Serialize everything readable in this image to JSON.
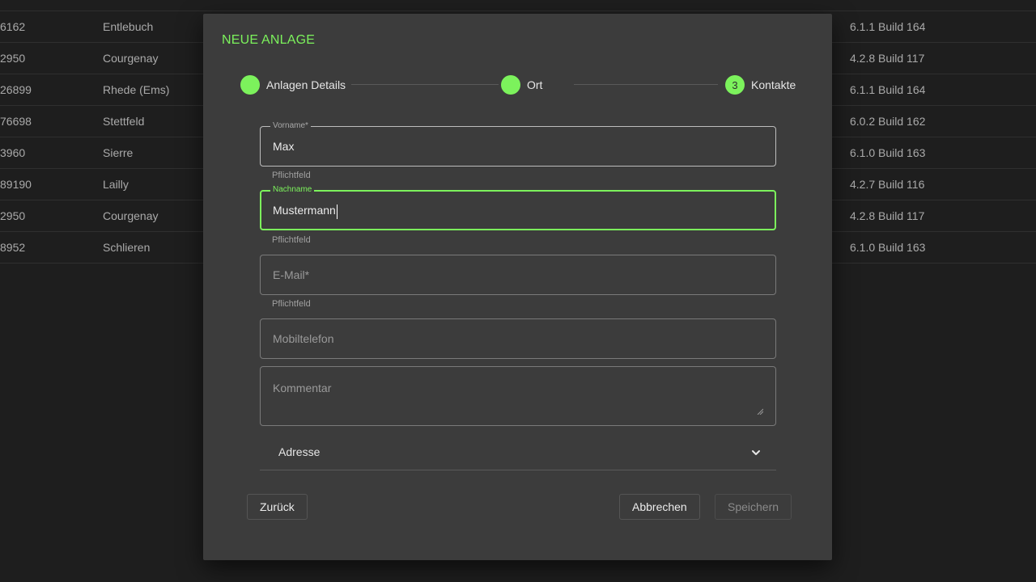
{
  "background_table": {
    "rows": [
      {
        "id": "6162",
        "city": "Entlebuch",
        "version": "6.1.1 Build 164"
      },
      {
        "id": "2950",
        "city": "Courgenay",
        "version": "4.2.8 Build 117"
      },
      {
        "id": "26899",
        "city": "Rhede (Ems)",
        "version": "6.1.1 Build 164"
      },
      {
        "id": "76698",
        "city": "Stettfeld",
        "version": "6.0.2 Build 162"
      },
      {
        "id": "3960",
        "city": "Sierre",
        "version": "6.1.0 Build 163"
      },
      {
        "id": "89190",
        "city": "Lailly",
        "version": "4.2.7 Build 116"
      },
      {
        "id": "2950",
        "city": "Courgenay",
        "version": "4.2.8 Build 117"
      },
      {
        "id": "8952",
        "city": "Schlieren",
        "version": "6.1.0 Build 163"
      }
    ]
  },
  "dialog": {
    "title": "NEUE ANLAGE",
    "steps": [
      {
        "label": "Anlagen Details",
        "number": ""
      },
      {
        "label": "Ort",
        "number": ""
      },
      {
        "label": "Kontakte",
        "number": "3"
      }
    ],
    "fields": {
      "vorname": {
        "label": "Vorname*",
        "value": "Max",
        "hint": "Pflichtfeld"
      },
      "nachname": {
        "label": "Nachname",
        "value": "Mustermann",
        "hint": "Pflichtfeld"
      },
      "email": {
        "placeholder": "E-Mail*",
        "value": "",
        "hint": "Pflichtfeld"
      },
      "mobil": {
        "placeholder": "Mobiltelefon",
        "value": ""
      },
      "kommentar": {
        "placeholder": "Kommentar",
        "value": ""
      }
    },
    "accordion": {
      "label": "Adresse",
      "icon": "chevron-down-icon"
    },
    "buttons": {
      "back": "Zurück",
      "cancel": "Abbrechen",
      "save": "Speichern"
    }
  },
  "colors": {
    "accent": "#7cf25c",
    "dialog_bg": "#3c3c3c",
    "page_bg": "#252525"
  }
}
